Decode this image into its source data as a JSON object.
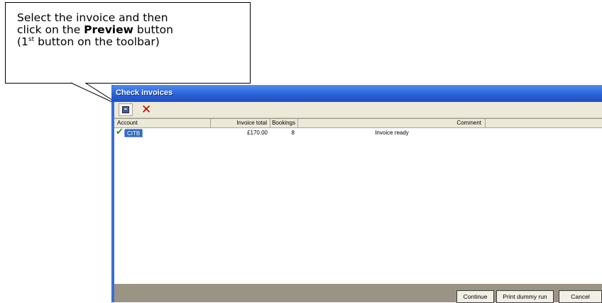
{
  "callout": {
    "line1": "Select the invoice and then",
    "line2_pre": "click on the ",
    "line2_bold": "Preview",
    "line2_post": " button",
    "line3_pre": "(1",
    "line3_sup": "st",
    "line3_post": " button on the toolbar)"
  },
  "window": {
    "title": "Check invoices"
  },
  "toolbar": {
    "preview_icon": "preview-icon",
    "delete_icon": "delete-icon"
  },
  "table": {
    "columns": [
      "Account",
      "Invoice total",
      "Bookings",
      "Comment"
    ],
    "rows": [
      {
        "status_icon": "check-icon",
        "account": "CITB",
        "invoice_total": "£170.00",
        "bookings": "8",
        "comment": "Invoice ready"
      }
    ]
  },
  "buttons": {
    "continue": "Continue",
    "print_dummy_run": "Print dummy run",
    "cancel": "Cancel"
  },
  "colors": {
    "titlebar": "#2a62d8",
    "selection": "#316ac5",
    "check": "#1e9a1e",
    "delete": "#c00000"
  }
}
